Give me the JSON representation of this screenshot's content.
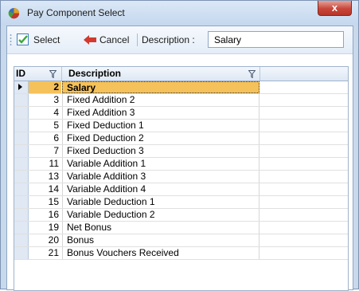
{
  "window": {
    "title": "Pay Component Select",
    "close_label": "x"
  },
  "toolbar": {
    "select_label": "Select",
    "cancel_label": "Cancel",
    "description_label": "Description :",
    "description_value": "Salary"
  },
  "grid": {
    "columns": {
      "id": "ID",
      "description": "Description"
    },
    "rows": [
      {
        "id": "2",
        "description": "Salary"
      },
      {
        "id": "3",
        "description": "Fixed Addition 2"
      },
      {
        "id": "4",
        "description": "Fixed Addition 3"
      },
      {
        "id": "5",
        "description": "Fixed Deduction 1"
      },
      {
        "id": "6",
        "description": "Fixed Deduction 2"
      },
      {
        "id": "7",
        "description": "Fixed Deduction 3"
      },
      {
        "id": "11",
        "description": "Variable Addition 1"
      },
      {
        "id": "13",
        "description": "Variable Addition 3"
      },
      {
        "id": "14",
        "description": "Variable Addition 4"
      },
      {
        "id": "15",
        "description": "Variable Deduction 1"
      },
      {
        "id": "16",
        "description": "Variable Deduction 2"
      },
      {
        "id": "19",
        "description": "Net Bonus"
      },
      {
        "id": "20",
        "description": "Bonus"
      },
      {
        "id": "21",
        "description": "Bonus Vouchers Received"
      }
    ]
  },
  "colors": {
    "selection": "#f5c15a",
    "close": "#c9463a",
    "header": "#dde7f3"
  }
}
